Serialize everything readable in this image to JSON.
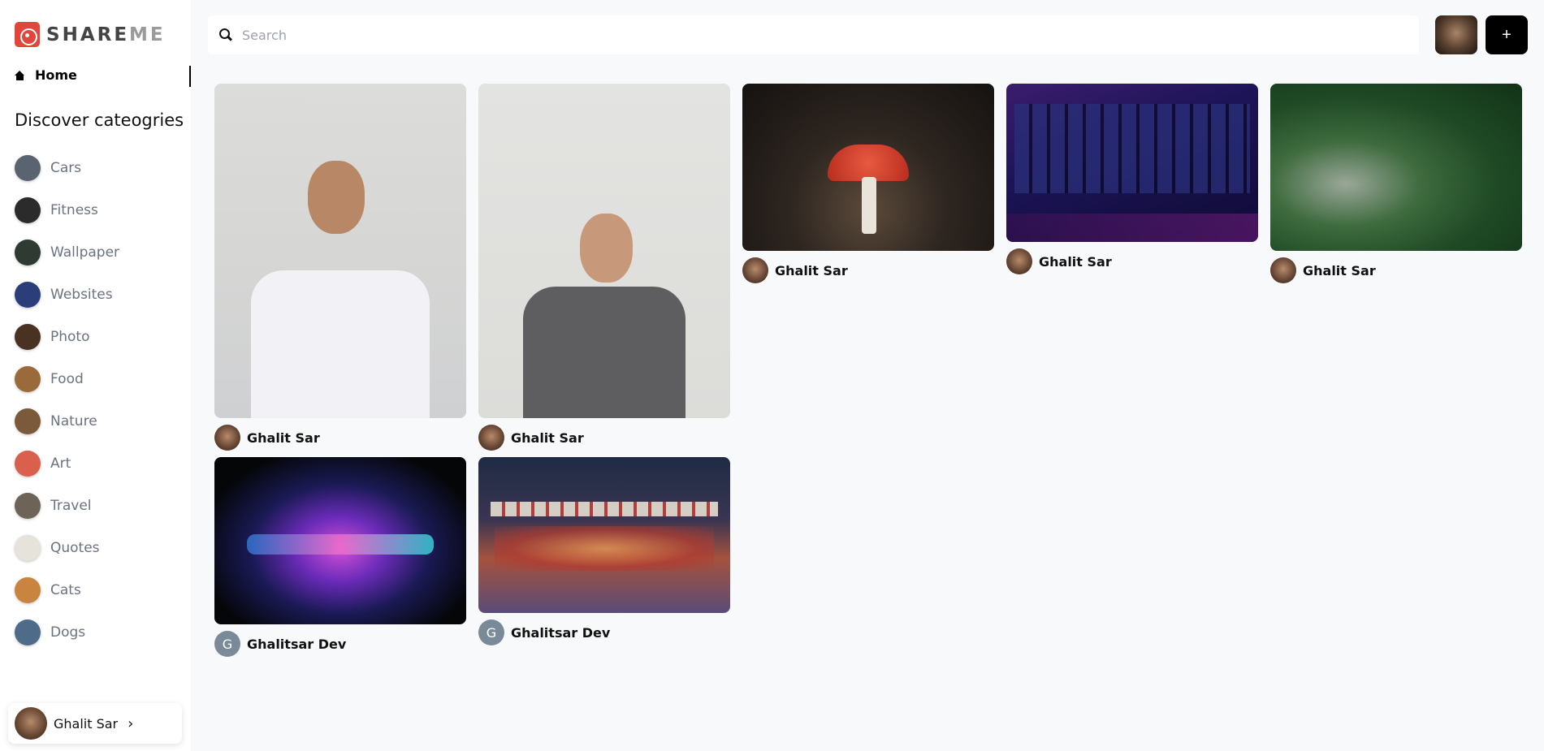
{
  "app": {
    "logo_text_main": "SHARE",
    "logo_text_accent": "ME",
    "brand_color": "#e2453c"
  },
  "sidebar": {
    "home_label": "Home",
    "discover_title": "Discover cateogries",
    "categories": [
      {
        "label": "Cars",
        "color": "#5a6470"
      },
      {
        "label": "Fitness",
        "color": "#2b2b2b"
      },
      {
        "label": "Wallpaper",
        "color": "#2f3a33"
      },
      {
        "label": "Websites",
        "color": "#2c3e7a"
      },
      {
        "label": "Photo",
        "color": "#4a3222"
      },
      {
        "label": "Food",
        "color": "#9b6a3a"
      },
      {
        "label": "Nature",
        "color": "#7a5a3a"
      },
      {
        "label": "Art",
        "color": "#d9604d"
      },
      {
        "label": "Travel",
        "color": "#6d6356"
      },
      {
        "label": "Quotes",
        "color": "#e6e3da"
      },
      {
        "label": "Cats",
        "color": "#c98540"
      },
      {
        "label": "Dogs",
        "color": "#4f6b8a"
      }
    ],
    "profile_name": "Ghalit Sar",
    "profile_chevron": "›"
  },
  "header": {
    "search_placeholder": "Search",
    "search_value": "",
    "add_label": "+"
  },
  "pins": [
    {
      "name": "Ghalit Sar",
      "avatar_letter": ""
    },
    {
      "name": "Ghalit Sar",
      "avatar_letter": ""
    },
    {
      "name": "Ghalit Sar",
      "avatar_letter": ""
    },
    {
      "name": "Ghalit Sar",
      "avatar_letter": ""
    },
    {
      "name": "Ghalit Sar",
      "avatar_letter": ""
    },
    {
      "name": "Ghalitsar Dev",
      "avatar_letter": "G"
    },
    {
      "name": "Ghalitsar Dev",
      "avatar_letter": "G"
    }
  ]
}
